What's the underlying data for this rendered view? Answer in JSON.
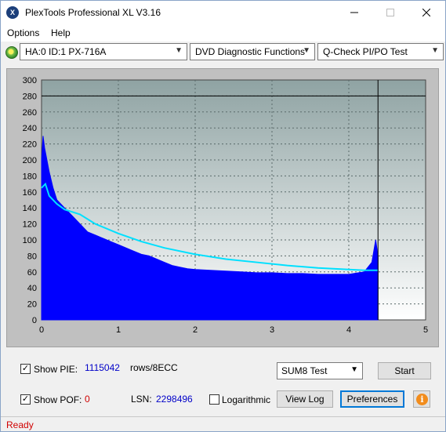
{
  "window": {
    "title": "PlexTools Professional XL V3.16",
    "app_icon_glyph": "X"
  },
  "menu": {
    "options": "Options",
    "help": "Help"
  },
  "toolbar": {
    "drive": "HA:0 ID:1  PX-716A",
    "function": "DVD Diagnostic Functions",
    "test": "Q-Check PI/PO Test"
  },
  "chart_data": {
    "type": "area",
    "y_ticks": [
      "0",
      "20",
      "40",
      "60",
      "80",
      "100",
      "120",
      "140",
      "160",
      "180",
      "200",
      "220",
      "240",
      "260",
      "280",
      "300"
    ],
    "x_ticks": [
      "0",
      "1",
      "2",
      "3",
      "4",
      "5"
    ],
    "xlim": [
      0,
      5
    ],
    "ylim": [
      0,
      300
    ],
    "grid": true,
    "reference_line_y": 280,
    "end_marker_x": 4.38,
    "series": [
      {
        "color": "#0000ff",
        "x": [
          0.0,
          0.02,
          0.04,
          0.06,
          0.08,
          0.1,
          0.15,
          0.2,
          0.3,
          0.4,
          0.5,
          0.6,
          0.7,
          0.8,
          0.9,
          1.0,
          1.1,
          1.2,
          1.3,
          1.4,
          1.5,
          1.6,
          1.7,
          1.8,
          1.9,
          2.0,
          2.2,
          2.4,
          2.6,
          2.8,
          3.0,
          3.2,
          3.4,
          3.6,
          3.8,
          4.0,
          4.2,
          4.3,
          4.35,
          4.38
        ],
        "values": [
          200,
          230,
          215,
          205,
          195,
          185,
          165,
          150,
          140,
          130,
          120,
          110,
          106,
          102,
          98,
          94,
          90,
          86,
          82,
          80,
          76,
          72,
          68,
          66,
          64,
          63,
          62,
          61,
          60,
          59,
          59,
          58,
          58,
          57,
          57,
          57,
          60,
          72,
          100,
          80
        ]
      },
      {
        "color": "#00e0ff",
        "x": [
          0.0,
          0.05,
          0.1,
          0.2,
          0.3,
          0.5,
          0.7,
          1.0,
          1.3,
          1.6,
          2.0,
          2.4,
          2.8,
          3.2,
          3.6,
          4.0,
          4.2,
          4.38
        ],
        "values": [
          165,
          170,
          155,
          145,
          138,
          132,
          120,
          108,
          98,
          90,
          82,
          76,
          72,
          68,
          65,
          63,
          62,
          62
        ]
      }
    ]
  },
  "controls": {
    "show_pie_label": "Show PIE:",
    "pie_value": "1115042",
    "pie_units": "rows/8ECC",
    "show_pof_label": "Show POF:",
    "pof_value": "0",
    "lsn_label": "LSN:",
    "lsn_value": "2298496",
    "logarithmic_label": "Logarithmic",
    "sum_test": "SUM8 Test",
    "start": "Start",
    "view_log": "View Log",
    "preferences": "Preferences",
    "info_glyph": "i",
    "check_mark": "✓"
  },
  "status": {
    "text": "Ready"
  }
}
